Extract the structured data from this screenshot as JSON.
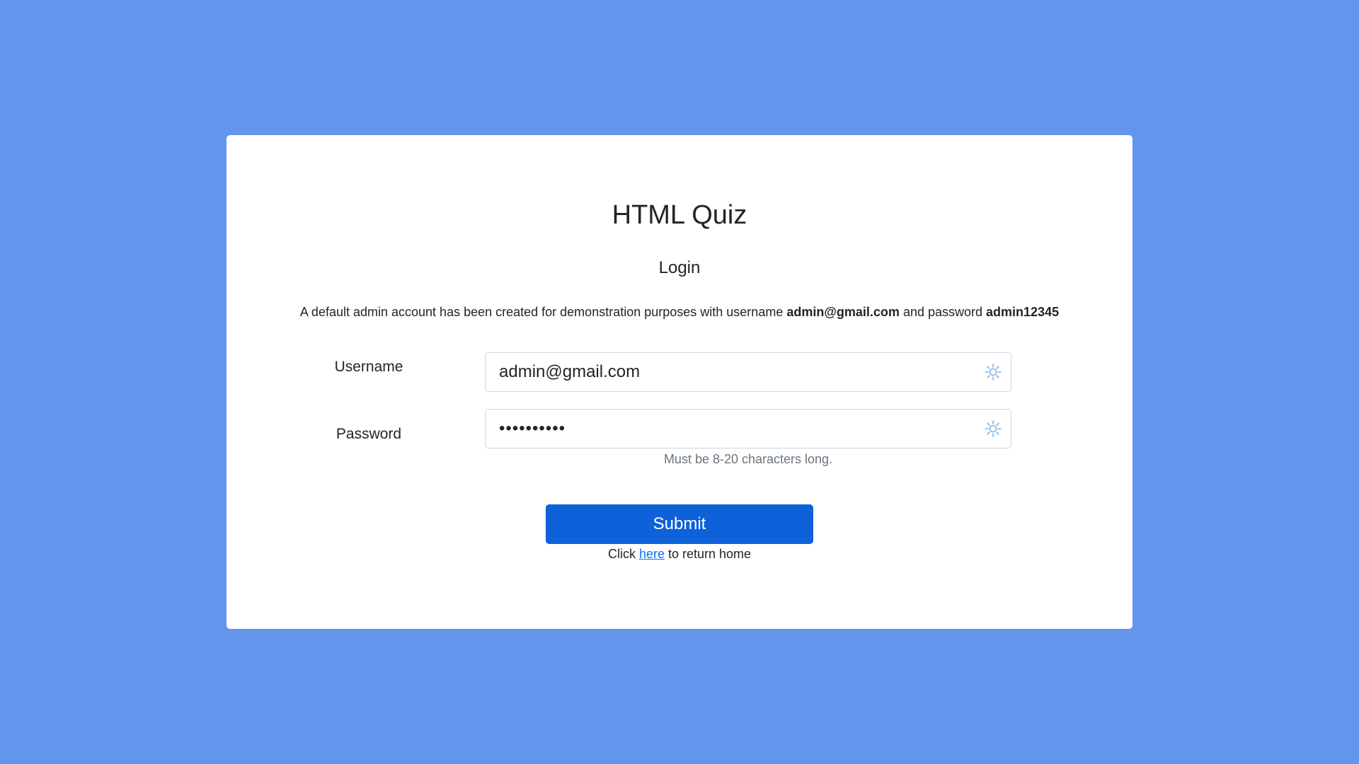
{
  "app": {
    "title": "HTML Quiz",
    "subtitle": "Login"
  },
  "notice": {
    "prefix": "A default admin account has been created for demonstration purposes with username ",
    "username": "admin@gmail.com",
    "middle": " and password ",
    "password": "admin12345"
  },
  "form": {
    "username_label": "Username",
    "username_value": "admin@gmail.com",
    "password_label": "Password",
    "password_value": "admin12345",
    "password_hint": "Must be 8-20 characters long.",
    "submit_label": "Submit",
    "field_icon": "autofill-gear-icon"
  },
  "footer": {
    "prefix": "Click ",
    "link_text": "here",
    "suffix": " to return home"
  },
  "colors": {
    "background": "#6495ed",
    "primary_button": "#0d61d9",
    "link": "#0d6efd",
    "hint": "#6c757d",
    "icon": "#7fb3e8"
  }
}
